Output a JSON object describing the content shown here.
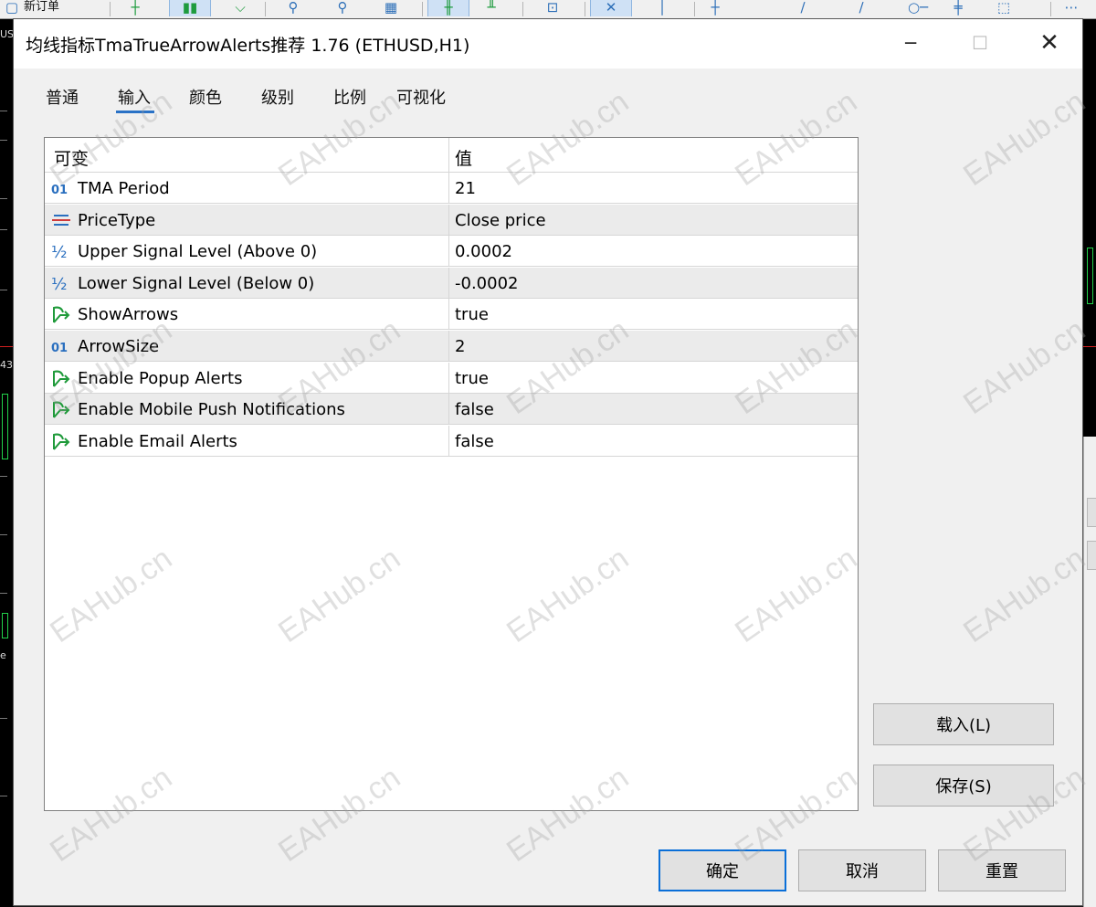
{
  "toolbar": {
    "text": "新订单"
  },
  "chart": {
    "left_labels": [
      "US",
      "43",
      "e"
    ],
    "colors": {
      "bull": "#22d04a",
      "level_line": "#d02020",
      "background": "#000000"
    }
  },
  "dialog": {
    "title": "均线指标TmaTrueArrowAlerts推荐 1.76 (ETHUSD,H1)",
    "tabs": [
      {
        "label": "普通",
        "active": false
      },
      {
        "label": "输入",
        "active": true
      },
      {
        "label": "颜色",
        "active": false
      },
      {
        "label": "级别",
        "active": false
      },
      {
        "label": "比例",
        "active": false
      },
      {
        "label": "可视化",
        "active": false
      }
    ],
    "table": {
      "headers": {
        "name": "可变",
        "value": "值"
      },
      "rows": [
        {
          "icon": "integer-icon",
          "name": "TMA Period",
          "value": "21"
        },
        {
          "icon": "enum-icon",
          "name": "PriceType",
          "value": "Close price"
        },
        {
          "icon": "double-icon",
          "name": "Upper Signal Level (Above 0)",
          "value": "0.0002"
        },
        {
          "icon": "double-icon",
          "name": "Lower Signal Level (Below 0)",
          "value": "-0.0002"
        },
        {
          "icon": "bool-icon",
          "name": "ShowArrows",
          "value": "true"
        },
        {
          "icon": "integer-icon",
          "name": "ArrowSize",
          "value": "2"
        },
        {
          "icon": "bool-icon",
          "name": "Enable Popup Alerts",
          "value": "true"
        },
        {
          "icon": "bool-icon",
          "name": "Enable Mobile Push Notifications",
          "value": "false"
        },
        {
          "icon": "bool-icon",
          "name": "Enable Email Alerts",
          "value": "false"
        }
      ]
    },
    "buttons": {
      "load": "载入(L)",
      "save": "保存(S)",
      "ok": "确定",
      "cancel": "取消",
      "reset": "重置"
    },
    "icon_glyphs": {
      "integer": "01",
      "double": "½"
    },
    "accent_color": "#0a6fd8"
  },
  "watermark": "EAHub.cn"
}
